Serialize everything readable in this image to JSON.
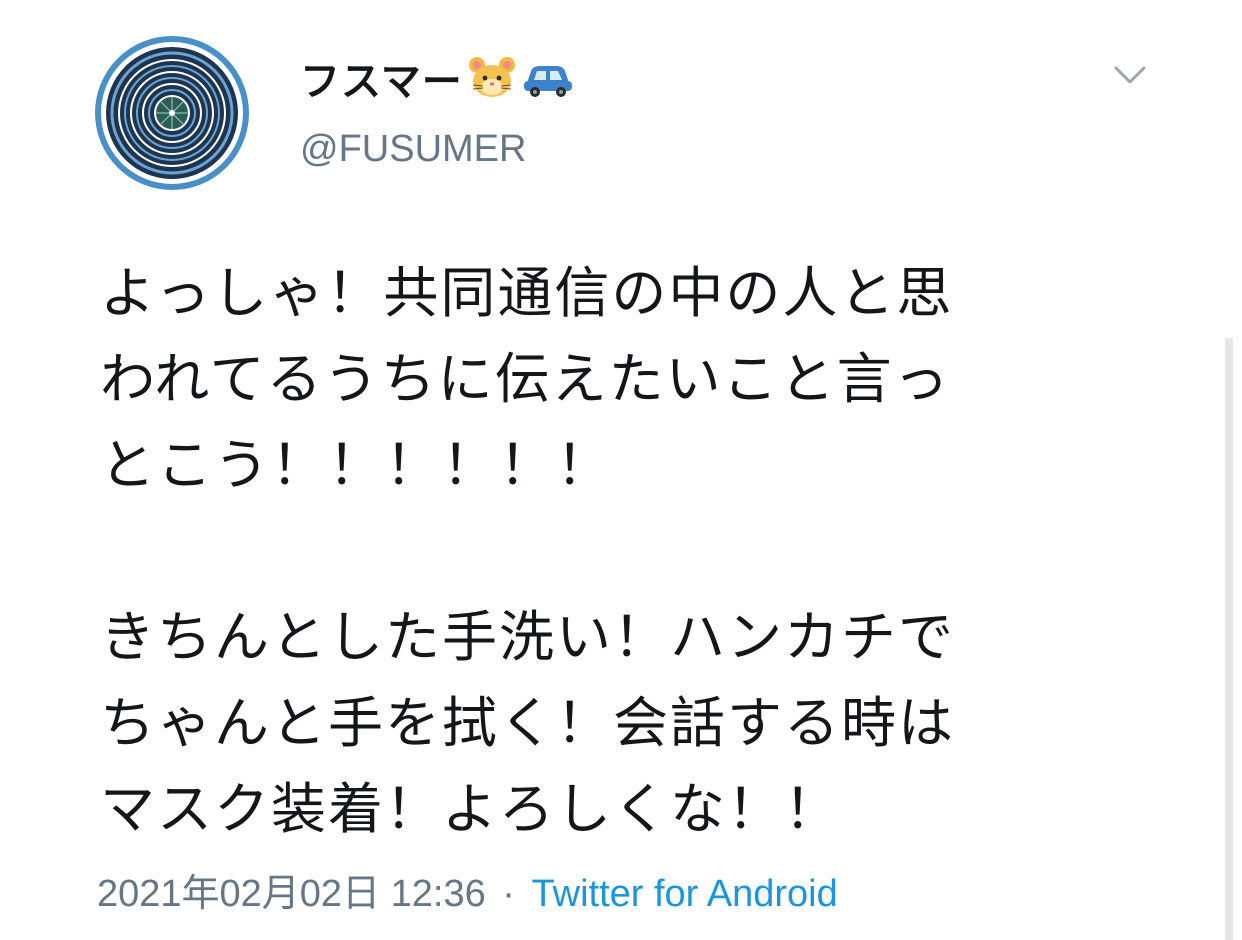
{
  "user": {
    "display_name": "フスマー",
    "emojis": [
      "hamster-face-emoji",
      "car-emoji"
    ],
    "handle": "@FUSUMER"
  },
  "tweet": {
    "paragraphs": [
      [
        "よっしゃ！共同通信の中の人と思",
        "われてるうちに伝えたいこと言っ",
        "とこう！！！！！！"
      ],
      [
        "きちんとした手洗い！ハンカチで",
        "ちゃんと手を拭く！会話する時は",
        "マスク装着！よろしくな！！"
      ]
    ],
    "timestamp": "2021年02月02日 12:36",
    "separator": "·",
    "source": "Twitter for Android"
  },
  "icons": {
    "more_menu": "chevron-down-icon"
  },
  "colors": {
    "text": "#14171a",
    "muted": "#657786",
    "link": "#1b95e0",
    "avatar_ring": "#4a90c8"
  }
}
